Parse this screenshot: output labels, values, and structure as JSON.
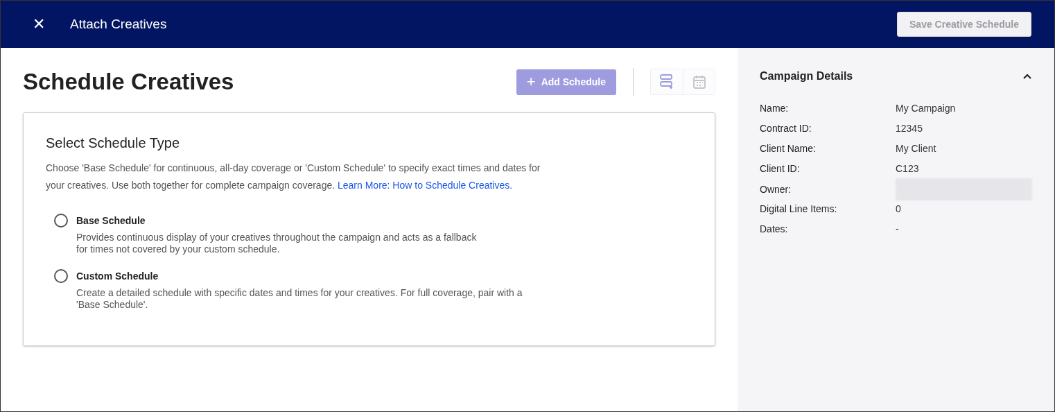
{
  "header": {
    "close_symbol": "✕",
    "title": "Attach Creatives",
    "save_button": {
      "label": "Save Creative Schedule",
      "disabled": true
    }
  },
  "main": {
    "title": "Schedule Creatives",
    "add_button": {
      "symbol": "+",
      "label": "Add Schedule",
      "disabled": true
    },
    "view_toggles": [
      {
        "kind": "list",
        "selected": true
      },
      {
        "kind": "calendar",
        "selected": false
      }
    ],
    "card": {
      "title": "Select Schedule Type",
      "intro": "Choose 'Base Schedule' for continuous, all-day coverage or 'Custom Schedule' to specify exact times and dates for your creatives. Use both together for complete campaign coverage.",
      "link": "Learn More: How to Schedule Creatives.",
      "options": [
        {
          "label": "Base Schedule",
          "description": "Provides continuous display of your creatives throughout the campaign and acts as a fallback for times not covered by your custom schedule.",
          "selected": false
        },
        {
          "label": "Custom Schedule",
          "description": "Create a detailed schedule with specific dates and times for your creatives. For full coverage, pair with a 'Base Schedule'.",
          "selected": false
        }
      ]
    }
  },
  "sidebar": {
    "title": "Campaign Details",
    "expanded": true,
    "details": [
      {
        "label": "Name:",
        "kind": "text",
        "value": "My Campaign"
      },
      {
        "label": "Contract ID:",
        "kind": "text",
        "value": "12345"
      },
      {
        "label": "Client Name:",
        "kind": "text",
        "value": "My Client"
      },
      {
        "label": "Client ID:",
        "kind": "text",
        "value": "C123"
      },
      {
        "label": "Owner:",
        "kind": "redacted"
      },
      {
        "label": "Digital Line Items:",
        "kind": "text",
        "value": "0"
      },
      {
        "label": "Dates:",
        "kind": "text",
        "value": "-"
      }
    ]
  }
}
